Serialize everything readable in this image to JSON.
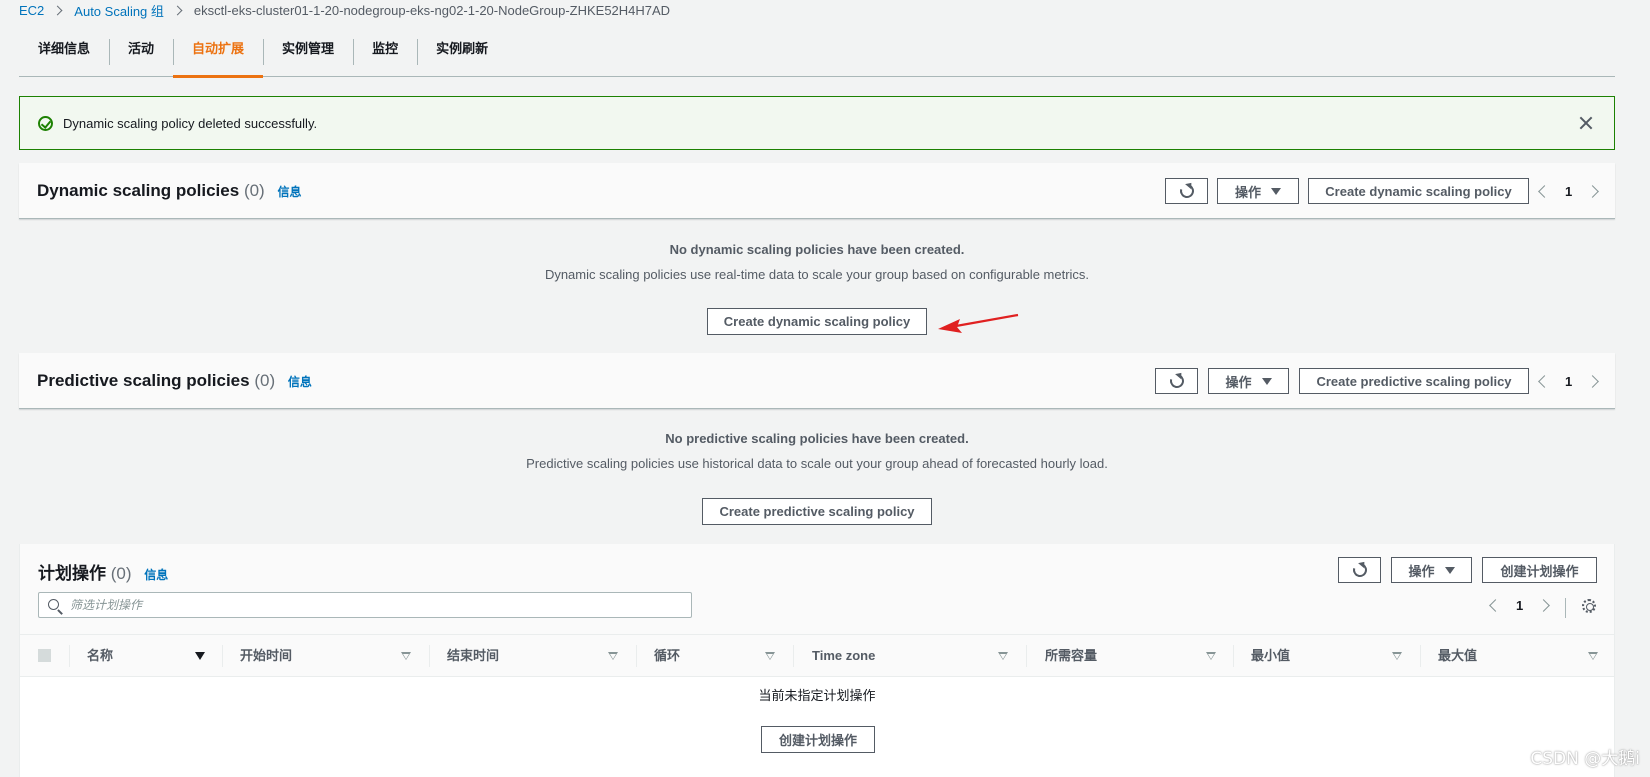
{
  "breadcrumb": {
    "items": [
      "EC2",
      "Auto Scaling 组",
      "eksctl-eks-cluster01-1-20-nodegroup-eks-ng02-1-20-NodeGroup-ZHKE52H4H7AD"
    ]
  },
  "tabs": [
    "详细信息",
    "活动",
    "自动扩展",
    "实例管理",
    "监控",
    "实例刷新"
  ],
  "active_tab": "自动扩展",
  "flash": {
    "message": "Dynamic scaling policy deleted successfully.",
    "status": "success",
    "color": "#1d8102"
  },
  "dynamic": {
    "title": "Dynamic scaling policies",
    "count": "(0)",
    "info": "信息",
    "actions_label": "操作",
    "create_label": "Create dynamic scaling policy",
    "page": "1",
    "empty_title": "No dynamic scaling policies have been created.",
    "empty_desc": "Dynamic scaling policies use real-time data to scale your group based on configurable metrics.",
    "empty_button": "Create dynamic scaling policy"
  },
  "predictive": {
    "title": "Predictive scaling policies",
    "count": "(0)",
    "info": "信息",
    "actions_label": "操作",
    "create_label": "Create predictive scaling policy",
    "page": "1",
    "empty_title": "No predictive scaling policies have been created.",
    "empty_desc": "Predictive scaling policies use historical data to scale out your group ahead of forecasted hourly load.",
    "empty_button": "Create predictive scaling policy"
  },
  "scheduled": {
    "title": "计划操作",
    "count": "(0)",
    "info": "信息",
    "actions_label": "操作",
    "create_label": "创建计划操作",
    "search_placeholder": "筛选计划操作",
    "page": "1",
    "columns": [
      "名称",
      "开始时间",
      "结束时间",
      "循环",
      "Time zone",
      "所需容量",
      "最小值",
      "最大值"
    ],
    "empty_text": "当前未指定计划操作",
    "empty_button": "创建计划操作"
  },
  "icons": {
    "flash": "success-check-icon",
    "close": "close-icon",
    "refresh": "refresh-icon",
    "search": "search-icon",
    "settings": "gear-icon"
  },
  "colors": {
    "accent": "#ec7211",
    "link": "#0073bb",
    "success": "#1d8102",
    "annotation": "#e02020"
  },
  "watermark": "CSDN @大鹅i"
}
